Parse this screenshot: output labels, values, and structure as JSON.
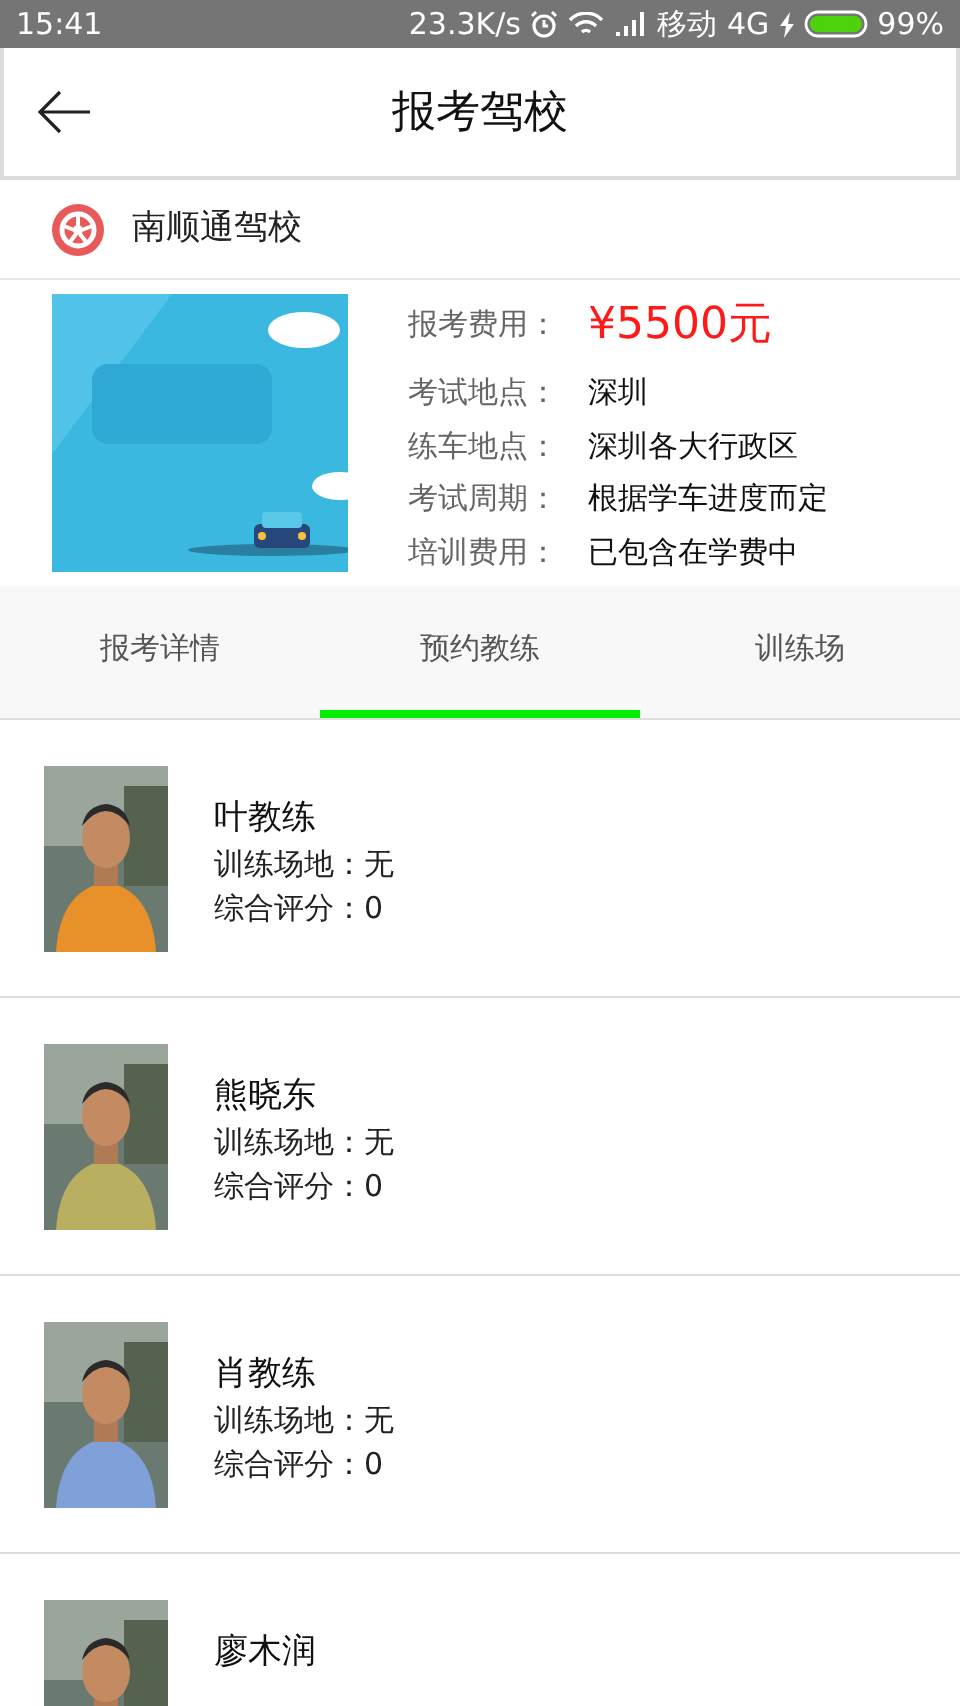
{
  "status_bar": {
    "time": "15:41",
    "speed": "23.3K/s",
    "carrier": "移动",
    "network": "4G",
    "battery": "99%"
  },
  "header": {
    "title": "报考驾校"
  },
  "school": {
    "name": "南顺通驾校"
  },
  "course": {
    "fee": {
      "label": "报考费用：",
      "value": "¥5500元"
    },
    "details": [
      {
        "label": "考试地点：",
        "value": "深圳"
      },
      {
        "label": "练车地点：",
        "value": "深圳各大行政区"
      },
      {
        "label": "考试周期：",
        "value": "根据学车进度而定"
      },
      {
        "label": "培训费用：",
        "value": "已包含在学费中"
      }
    ]
  },
  "tabs": [
    {
      "label": "报考详情",
      "selected": false
    },
    {
      "label": "预约教练",
      "selected": true
    },
    {
      "label": "训练场",
      "selected": false
    }
  ],
  "coaches": [
    {
      "name": "叶教练",
      "venue": "训练场地：无",
      "rating": "综合评分：0"
    },
    {
      "name": "熊晓东",
      "venue": "训练场地：无",
      "rating": "综合评分：0"
    },
    {
      "name": "肖教练",
      "venue": "训练场地：无",
      "rating": "综合评分：0"
    },
    {
      "name": "廖木润"
    }
  ]
}
